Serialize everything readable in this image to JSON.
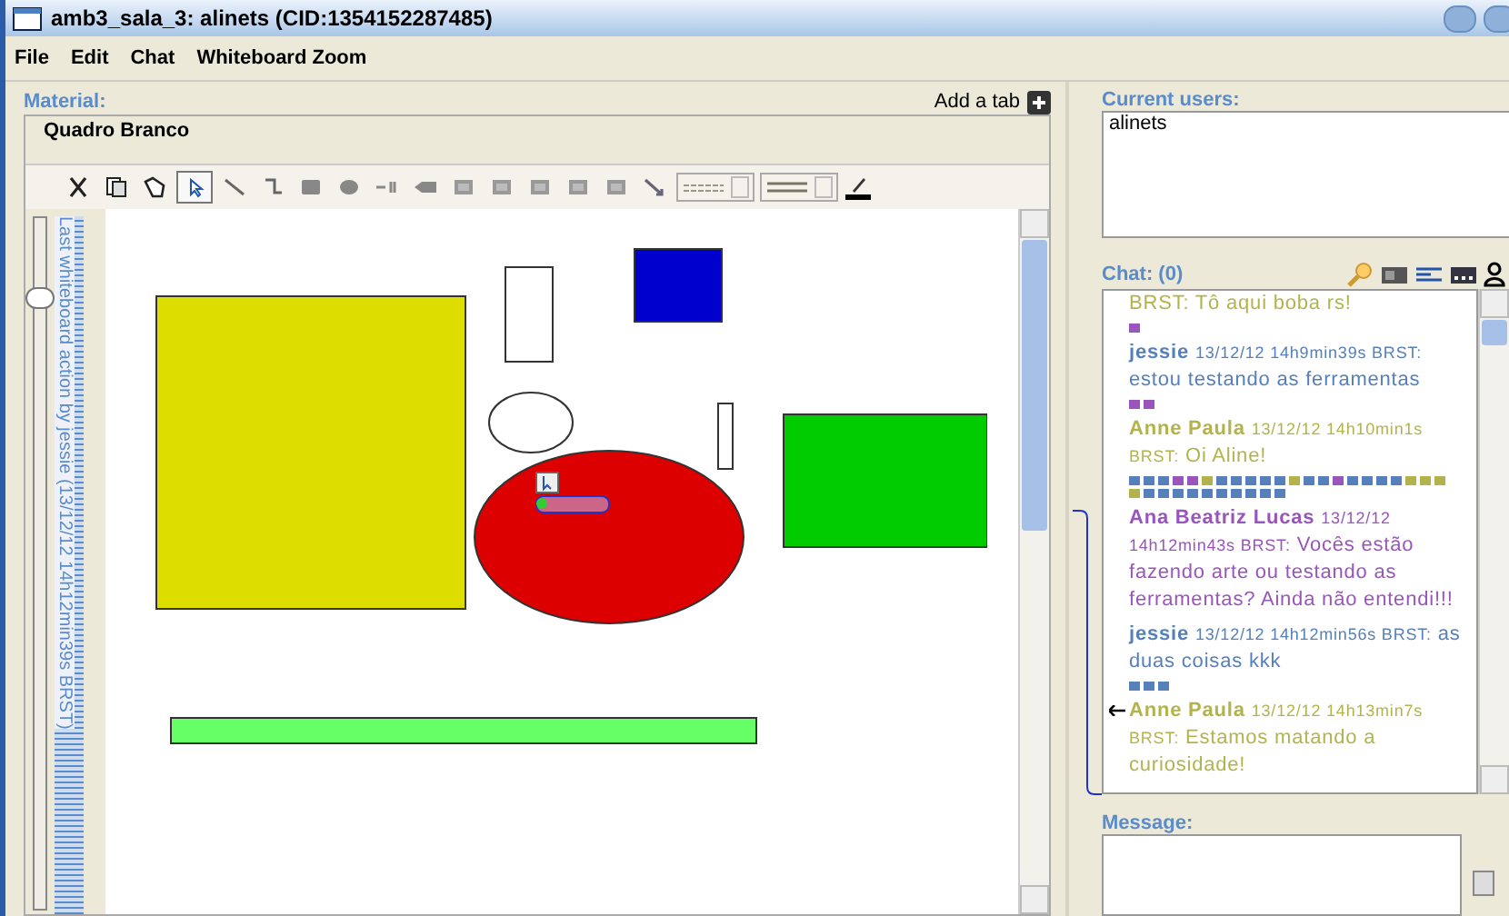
{
  "window": {
    "title": "amb3_sala_3: alinets (CID:1354152287485)"
  },
  "menu": [
    "File",
    "Edit",
    "Chat",
    "Whiteboard Zoom"
  ],
  "material": {
    "label": "Material:",
    "add_tab": "Add a tab",
    "tab": "Quadro Branco",
    "zoom": {
      "level": 0.9
    },
    "last_action": "Last whiteboard action by jessie (13/12/12 14h12min39s BRST)",
    "shapes": [
      {
        "kind": "rect",
        "color": "#dddd00"
      },
      {
        "kind": "rect",
        "color": "#ffffff"
      },
      {
        "kind": "rect",
        "color": "#0000cc"
      },
      {
        "kind": "ellipse",
        "color": "#ffffff"
      },
      {
        "kind": "rect",
        "color": "#ffffff"
      },
      {
        "kind": "rect",
        "color": "#00cc00"
      },
      {
        "kind": "ellipse",
        "color": "#dd0000"
      },
      {
        "kind": "rect",
        "color": "#66ff66"
      }
    ]
  },
  "users": {
    "label": "Current users:",
    "items": [
      "alinets"
    ]
  },
  "chat": {
    "label": "Chat: (0)",
    "messages": [
      {
        "text": "BRST: Tô aqui boba rs!",
        "color": "#b3b34d",
        "marks": [
          {
            "color": "#9955bb"
          }
        ],
        "arrow": false
      },
      {
        "author": "jessie",
        "time": "13/12/12 14h9min39s BRST:",
        "text": "estou testando as ferramentas",
        "color": "#5580bb",
        "marks": [
          {
            "color": "#9955bb"
          },
          {
            "color": "#9955bb"
          }
        ],
        "arrow": false
      },
      {
        "author": "Anne Paula",
        "time": "13/12/12 14h10min1s BRST:",
        "text": "Oi Aline!",
        "color": "#b3b34d",
        "marks": [
          {
            "color": "#5580bb"
          },
          {
            "color": "#5580bb"
          },
          {
            "color": "#5580bb"
          },
          {
            "color": "#9955bb"
          },
          {
            "color": "#9955bb"
          },
          {
            "color": "#b3b34d"
          },
          {
            "color": "#5580bb"
          },
          {
            "color": "#5580bb"
          },
          {
            "color": "#5580bb"
          },
          {
            "color": "#5580bb"
          },
          {
            "color": "#5580bb"
          },
          {
            "color": "#b3b34d"
          },
          {
            "color": "#5580bb"
          },
          {
            "color": "#5580bb"
          },
          {
            "color": "#9955bb"
          },
          {
            "color": "#5580bb"
          },
          {
            "color": "#5580bb"
          },
          {
            "color": "#5580bb"
          },
          {
            "color": "#5580bb"
          },
          {
            "color": "#b3b34d"
          },
          {
            "color": "#b3b34d"
          },
          {
            "color": "#b3b34d"
          },
          {
            "color": "#b3b34d"
          },
          {
            "color": "#5580bb"
          },
          {
            "color": "#5580bb"
          },
          {
            "color": "#5580bb"
          },
          {
            "color": "#5580bb"
          },
          {
            "color": "#5580bb"
          },
          {
            "color": "#5580bb"
          },
          {
            "color": "#5580bb"
          },
          {
            "color": "#5580bb"
          },
          {
            "color": "#5580bb"
          },
          {
            "color": "#5580bb"
          }
        ],
        "arrow": false
      },
      {
        "author": "Ana Beatriz Lucas",
        "time": "13/12/12 14h12min43s BRST:",
        "text": "Vocês estão fazendo arte ou testando as ferramentas? Ainda não entendi!!!",
        "color": "#9955bb",
        "arrow": false
      },
      {
        "author": "jessie",
        "time": "13/12/12 14h12min56s BRST:",
        "text": "as duas coisas kkk",
        "color": "#5580bb",
        "marks": [
          {
            "color": "#5580bb"
          },
          {
            "color": "#5580bb"
          },
          {
            "color": "#5580bb"
          }
        ],
        "arrow": false
      },
      {
        "author": "Anne Paula",
        "time": "13/12/12 14h13min7s BRST:",
        "text": "Estamos matando a curiosidade!",
        "color": "#b3b34d",
        "arrow": true
      }
    ]
  },
  "message": {
    "label": "Message:"
  }
}
